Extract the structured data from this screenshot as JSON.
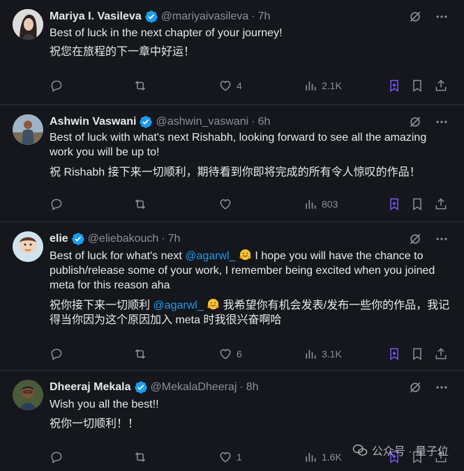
{
  "tweets": [
    {
      "name": "Mariya I. Vasileva",
      "handle": "@mariyaivasileva",
      "time": "7h",
      "lines": [
        "Best of luck in the next chapter of your journey!",
        "祝您在旅程的下一章中好运！"
      ],
      "likes": "4",
      "views": "2.1K"
    },
    {
      "name": "Ashwin Vaswani",
      "handle": "@ashwin_vaswani",
      "time": "6h",
      "lines": [
        "Best of luck with what's next Rishabh, looking forward to see all the amazing work you will be up to!",
        "祝 Rishabh 接下来一切顺利，期待看到你即将完成的所有令人惊叹的作品！"
      ],
      "likes": "",
      "views": "803"
    },
    {
      "name": "elie",
      "handle": "@eliebakouch",
      "time": "7h",
      "en_pre": "Best of luck for what's next ",
      "en_mention": "@agarwl_",
      "en_post": " I hope you will have the chance to publish/release some of your work, I remember being excited when you joined meta for this reason aha",
      "zh_pre": "祝你接下来一切顺利 ",
      "zh_mention": "@agarwl_",
      "zh_post": " 我希望你有机会发表/发布一些你的作品，我记得当你因为这个原因加入 meta 时我很兴奋啊哈",
      "likes": "6",
      "views": "3.1K"
    },
    {
      "name": "Dheeraj Mekala",
      "handle": "@MekalaDheeraj",
      "time": "8h",
      "lines": [
        "Wish you all the best!!",
        "祝你一切顺利！！"
      ],
      "likes": "1",
      "views": "1.6K"
    }
  ],
  "separator": "·",
  "watermark": "公众号 · 量子位",
  "colors": {
    "background": "#15171c",
    "text": "#e7e9ea",
    "muted": "#8b9198",
    "verified": "#1d9bf0",
    "bookmark_accent": "#7856ff"
  },
  "icons": [
    "verified-badge-icon",
    "grok-icon",
    "more-icon",
    "reply-icon",
    "retweet-icon",
    "like-icon",
    "views-icon",
    "grok-bookmark-icon",
    "bookmark-icon",
    "share-icon"
  ]
}
